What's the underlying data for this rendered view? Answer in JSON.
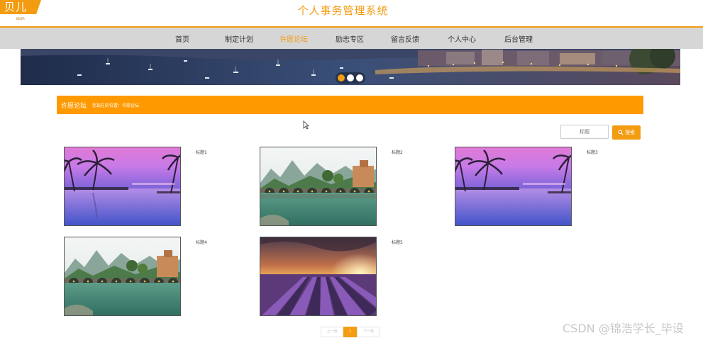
{
  "header": {
    "logo_text": "贝儿",
    "logo_sub": "BEIER",
    "site_title": "个人事务管理系统",
    "accent_color": "#f39c12"
  },
  "nav": {
    "items": [
      {
        "label": "首页",
        "active": false
      },
      {
        "label": "制定计划",
        "active": false
      },
      {
        "label": "许愿论坛",
        "active": true
      },
      {
        "label": "励志专区",
        "active": false
      },
      {
        "label": "留言反馈",
        "active": false
      },
      {
        "label": "个人中心",
        "active": false
      },
      {
        "label": "后台管理",
        "active": false
      }
    ]
  },
  "banner": {
    "slide_count": 3,
    "active_slide": 1
  },
  "breadcrumb": {
    "title": "许愿论坛",
    "path": "您现在的位置：许愿论坛"
  },
  "search": {
    "placeholder": "标题",
    "value": "",
    "button_label": "搜索",
    "button_icon": "search-icon"
  },
  "posts": [
    {
      "title": "标题1",
      "image": "tropical-sunset-pool"
    },
    {
      "title": "标题2",
      "image": "karst-bridge-river"
    },
    {
      "title": "标题3",
      "image": "tropical-sunset-pool"
    },
    {
      "title": "标题4",
      "image": "karst-bridge-river"
    },
    {
      "title": "标题5",
      "image": "lavender-field-sunset"
    }
  ],
  "pagination": {
    "prev_label": "上一页",
    "current_page": "1",
    "next_label": "下一页"
  },
  "watermark": "CSDN @锦浩学长_毕设"
}
